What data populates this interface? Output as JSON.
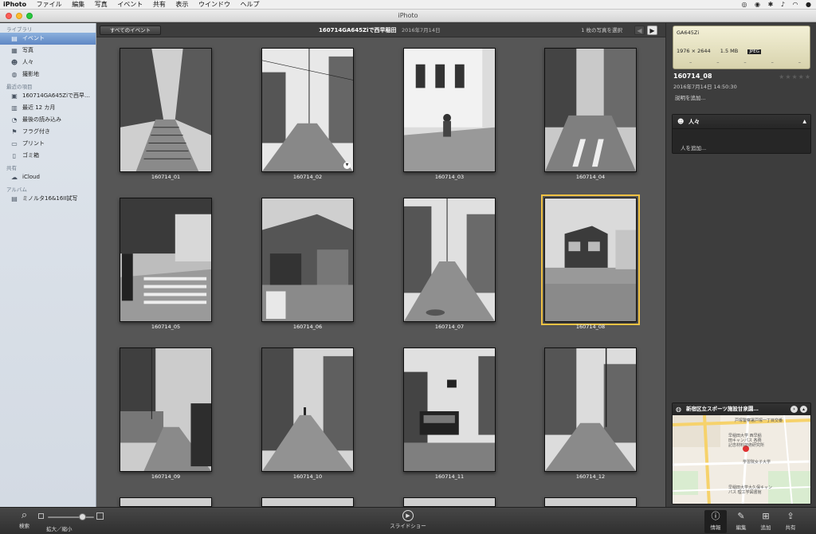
{
  "menubar": {
    "app_name": "iPhoto",
    "items": [
      "ファイル",
      "編集",
      "写真",
      "イベント",
      "共有",
      "表示",
      "ウインドウ",
      "ヘルプ"
    ]
  },
  "window": {
    "title": "iPhoto"
  },
  "sidebar": {
    "library_header": "ライブラリ",
    "library_items": [
      {
        "label": "イベント",
        "icon": "events-icon",
        "selected": true
      },
      {
        "label": "写真",
        "icon": "photos-icon",
        "selected": false
      },
      {
        "label": "人々",
        "icon": "faces-icon",
        "selected": false
      },
      {
        "label": "撮影地",
        "icon": "places-icon",
        "selected": false
      }
    ],
    "recent_header": "最近の項目",
    "recent_items": [
      {
        "label": "160714GA645Ziで西早…",
        "icon": "event-thumb-icon"
      },
      {
        "label": "最近 12 カ月",
        "icon": "calendar-icon"
      },
      {
        "label": "最後の読み込み",
        "icon": "clock-icon"
      },
      {
        "label": "フラグ付き",
        "icon": "flag-icon"
      },
      {
        "label": "プリント",
        "icon": "print-icon"
      },
      {
        "label": "ゴミ箱",
        "icon": "trash-icon"
      }
    ],
    "shared_header": "共有",
    "shared_items": [
      {
        "label": "iCloud",
        "icon": "icloud-icon"
      }
    ],
    "albums_header": "アルバム",
    "album_items": [
      {
        "label": "ミノルタ16&16II試写",
        "icon": "album-icon"
      }
    ]
  },
  "toolbar": {
    "all_events_label": "すべてのイベント",
    "event_title": "160714GA645Ziで西早稲田",
    "event_date": "2016年7月14日",
    "selection_count": "1 枚の写真を選択"
  },
  "photos": [
    {
      "label": "160714_01",
      "scene": "stairs"
    },
    {
      "label": "160714_02",
      "scene": "street"
    },
    {
      "label": "160714_03",
      "scene": "building"
    },
    {
      "label": "160714_04",
      "scene": "road"
    },
    {
      "label": "160714_05",
      "scene": "crosswalk"
    },
    {
      "label": "160714_06",
      "scene": "shop"
    },
    {
      "label": "160714_07",
      "scene": "alley"
    },
    {
      "label": "160714_08",
      "scene": "house"
    },
    {
      "label": "160714_09",
      "scene": "wall"
    },
    {
      "label": "160714_10",
      "scene": "alley2"
    },
    {
      "label": "160714_11",
      "scene": "bus"
    },
    {
      "label": "160714_12",
      "scene": "lane"
    }
  ],
  "selected_photo_index": 7,
  "info": {
    "camera_model": "GA645Zi",
    "dimensions": "1976 × 2644",
    "file_size": "1.5 MB",
    "format": "JPEG",
    "photo_name": "160714_08",
    "datetime": "2016年7月14日 14:50:30",
    "rating": 0,
    "add_description": "説明を追加...",
    "faces_title": "人々",
    "add_faces": "人を追加...",
    "map_title": "新宿区立スポーツ施設甘泉園…",
    "map_labels": [
      "戸塚警察署戸塚一丁目交番",
      "早稲田大学 西早稲",
      "田キャンパス 各務",
      "記念材料技術研究所",
      "学習院女子大学",
      "早稲田大学大久保キャン",
      "パス 理工学図書館"
    ]
  },
  "bottombar": {
    "search_label": "検索",
    "zoom_label": "拡大／縮小",
    "zoom_level": 0.8,
    "slideshow_label": "スライドショー",
    "tools": [
      {
        "label": "情報",
        "icon": "info-icon",
        "active": true
      },
      {
        "label": "編集",
        "icon": "edit-icon",
        "active": false
      },
      {
        "label": "追加",
        "icon": "add-icon",
        "active": false
      },
      {
        "label": "共有",
        "icon": "share-icon",
        "active": false
      }
    ]
  },
  "colors": {
    "selection": "#f0c244",
    "sidebar_selected": "#6f96cf",
    "grid_bg": "#565656"
  }
}
